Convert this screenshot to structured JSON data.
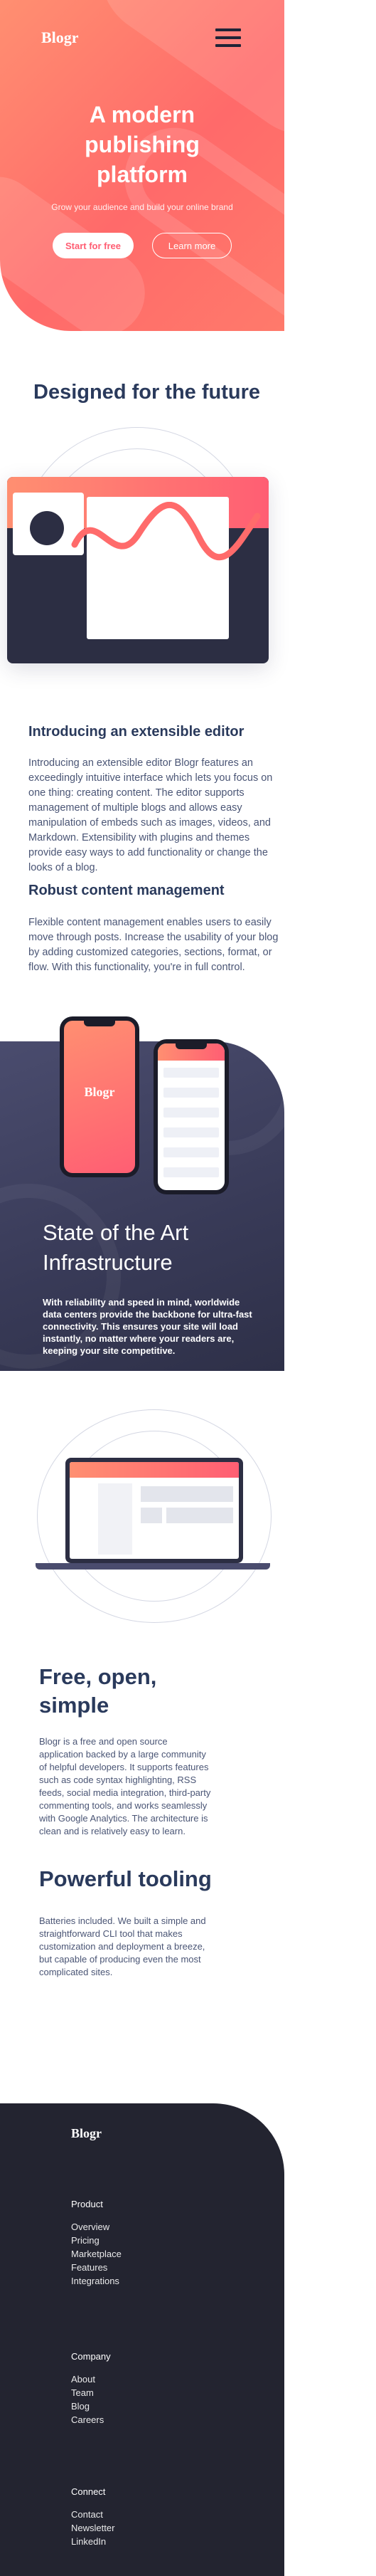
{
  "header": {
    "logo": "Blogr",
    "menu_icon": "hamburger-menu-icon"
  },
  "hero": {
    "title": "A modern publishing platform",
    "subtitle": "Grow your audience and build your online brand",
    "start_label": "Start for free",
    "learn_label": "Learn more"
  },
  "future": {
    "title": "Designed for the future",
    "editor_heading": "Introducing an extensible editor",
    "editor_text": "Introducing an extensible editor Blogr features an exceedingly intuitive interface which lets you focus on one thing: creating content. The editor supports management of multiple blogs and allows easy manipulation of embeds such as images, videos, and Markdown. Extensibility with plugins and themes provide easy ways to add functionality or change the looks of a blog.",
    "content_heading": "Robust content management",
    "content_text": "Flexible content management enables users to easily move through posts. Increase the usability of your blog by adding customized categories, sections, format, or flow. With this functionality, you're in full control."
  },
  "infra": {
    "phone_logo": "Blogr",
    "title": "State of the Art Infrastructure",
    "text": "With reliability and speed in mind, worldwide data centers provide the backbone for ultra-fast connectivity. This ensures your site will load instantly, no matter where your readers are, keeping your site competitive."
  },
  "free": {
    "title": "Free, open, simple",
    "text": "Blogr is a free and open source application backed by a large community of helpful developers. It supports features such as code syntax highlighting, RSS feeds, social media integration, third-party commenting tools, and works seamlessly with Google Analytics. The architecture is clean and is relatively easy to learn.",
    "tooling_title": "Powerful tooling",
    "tooling_text": "Batteries included. We built a simple and straightforward CLI tool that makes customization and deployment a breeze, but capable of producing even the most complicated sites."
  },
  "footer": {
    "logo": "Blogr",
    "product": {
      "heading": "Product",
      "links": [
        "Overview",
        "Pricing",
        "Marketplace",
        "Features",
        "Integrations"
      ]
    },
    "company": {
      "heading": "Company",
      "links": [
        "About",
        "Team",
        "Blog",
        "Careers"
      ]
    },
    "connect": {
      "heading": "Connect",
      "links": [
        "Contact",
        "Newsletter",
        "LinkedIn"
      ]
    }
  },
  "colors": {
    "accent": "#ff5e73",
    "accent_light": "#ff8f71",
    "heading": "#2a3a5c",
    "dark": "#232430"
  }
}
